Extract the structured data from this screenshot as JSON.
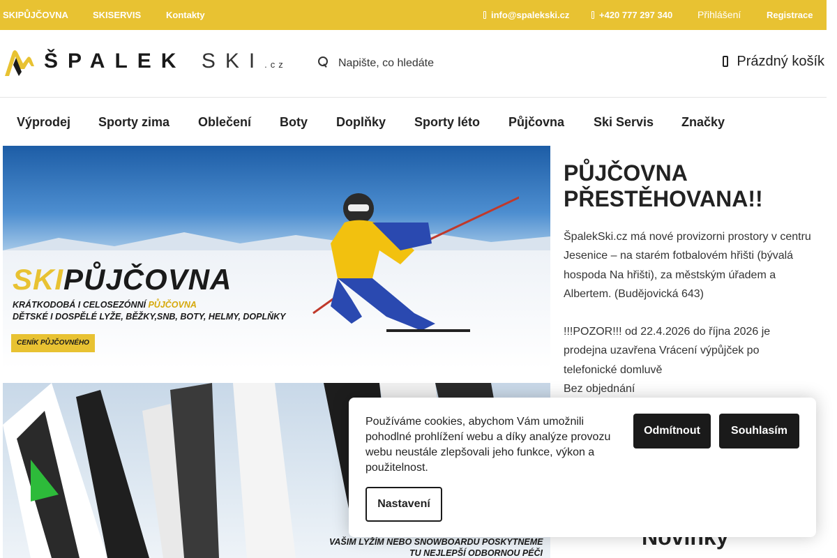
{
  "topbar": {
    "links": [
      "SKIPŮJČOVNA",
      "SKISERVIS",
      "Kontakty"
    ],
    "email": "info@spalekski.cz",
    "phone": "+420 777 297 340",
    "login": "Přihlášení",
    "register": "Registrace"
  },
  "header": {
    "logo": {
      "name": "ŠPALEK",
      "suffix": "SKI",
      "domain": ".cz"
    },
    "search_placeholder": "Napište, co hledáte",
    "cart_label": "Prázdný košík"
  },
  "nav": {
    "items": [
      "Výprodej",
      "Sporty zima",
      "Oblečení",
      "Boty",
      "Doplňky",
      "Sporty léto",
      "Půjčovna",
      "Ski Servis",
      "Značky"
    ]
  },
  "banner1": {
    "title_ski": "SKI",
    "title_rest": "PŮJČOVNA",
    "subtitle1_a": "KRÁTKODOBÁ I CELOSEZÓNNÍ ",
    "subtitle1_b": "PŮJČOVNA",
    "subtitle2": "DĚTSKÉ I DOSPĚLÉ LYŽE, BĚŽKY,SNB, BOTY, HELMY, DOPLŇKY",
    "button": "CENÍK PŮJČOVNÉHO"
  },
  "banner2": {
    "line1": "VAŠIM LYŽÍM NEBO SNOWBOARDU POSKYTNEME",
    "line2": "TU NEJLEPŠÍ ODBORNOU PÉČI"
  },
  "side": {
    "title": "PŮJČOVNA PŘESTĚHOVANA!! ",
    "p1": "ŠpalekSki.cz má nové provizorni prostory v centru Jesenice – na starém fotbalovém hřišti (bývalá hospoda Na hřišti), za městským úřadem a Albertem. (Budějovická 643)",
    "p2": "!!!POZOR!!! od 22.4.2026 do října 2026 je prodejna uzavřena  Vrácení výpůjček po telefonické domluvě",
    "p3": " Bez objednání",
    "novinky": "Novinky"
  },
  "cookie": {
    "text": "Používáme cookies, abychom Vám umožnili pohodlné prohlížení webu a díky analýze provozu webu neustále zlepšovali jeho funkce, výkon a použitelnost.",
    "decline": "Odmítnout",
    "accept": "Souhlasím",
    "settings": "Nastavení"
  },
  "colors": {
    "accent": "#e8c232",
    "dark": "#1a1a1a"
  }
}
